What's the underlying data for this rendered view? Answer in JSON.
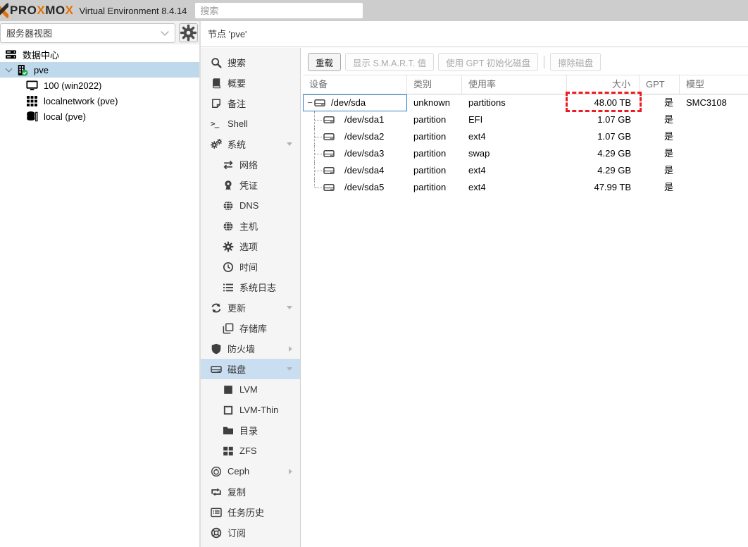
{
  "topbar": {
    "brand": "PROXMOX",
    "subtitle": "Virtual Environment 8.4.14",
    "search_placeholder": "搜索"
  },
  "sidebar": {
    "view_selector": "服务器视图",
    "tree": [
      {
        "id": "datacenter",
        "label": "数据中心",
        "icon": "server",
        "level": 0,
        "chevron": false,
        "selected": false
      },
      {
        "id": "pve",
        "label": "pve",
        "icon": "node",
        "level": 1,
        "chevron": true,
        "selected": true
      },
      {
        "id": "vm-100",
        "label": "100 (win2022)",
        "icon": "desktop",
        "level": 2,
        "chevron": false,
        "selected": false
      },
      {
        "id": "sdn-localnetwork",
        "label": "localnetwork (pve)",
        "icon": "th",
        "level": 2,
        "chevron": false,
        "selected": false
      },
      {
        "id": "storage-local",
        "label": "local (pve)",
        "icon": "storage",
        "level": 2,
        "chevron": false,
        "selected": false
      }
    ]
  },
  "content_header": {
    "title": "节点 'pve'"
  },
  "nav": {
    "items": [
      {
        "id": "search",
        "label": "搜索",
        "icon": "search",
        "level": 0,
        "chevron": "",
        "selected": false
      },
      {
        "id": "summary",
        "label": "概要",
        "icon": "book",
        "level": 0,
        "chevron": "",
        "selected": false
      },
      {
        "id": "notes",
        "label": "备注",
        "icon": "note",
        "level": 0,
        "chevron": "",
        "selected": false
      },
      {
        "id": "shell",
        "label": "Shell",
        "icon": "terminal",
        "level": 0,
        "chevron": "",
        "selected": false
      },
      {
        "id": "system",
        "label": "系统",
        "icon": "cogs",
        "level": 0,
        "chevron": "down",
        "selected": false
      },
      {
        "id": "network",
        "label": "网络",
        "icon": "exchange",
        "level": 1,
        "chevron": "",
        "selected": false
      },
      {
        "id": "certificates",
        "label": "凭证",
        "icon": "certificate",
        "level": 1,
        "chevron": "",
        "selected": false
      },
      {
        "id": "dns",
        "label": "DNS",
        "icon": "globe",
        "level": 1,
        "chevron": "",
        "selected": false
      },
      {
        "id": "hosts",
        "label": "主机",
        "icon": "globe",
        "level": 1,
        "chevron": "",
        "selected": false
      },
      {
        "id": "options",
        "label": "选项",
        "icon": "gear",
        "level": 1,
        "chevron": "",
        "selected": false
      },
      {
        "id": "time",
        "label": "时间",
        "icon": "clock",
        "level": 1,
        "chevron": "",
        "selected": false
      },
      {
        "id": "syslog",
        "label": "系统日志",
        "icon": "list",
        "level": 1,
        "chevron": "",
        "selected": false
      },
      {
        "id": "updates",
        "label": "更新",
        "icon": "refresh",
        "level": 0,
        "chevron": "down",
        "selected": false
      },
      {
        "id": "repositories",
        "label": "存储库",
        "icon": "copy",
        "level": 1,
        "chevron": "",
        "selected": false
      },
      {
        "id": "firewall",
        "label": "防火墙",
        "icon": "shield",
        "level": 0,
        "chevron": "right",
        "selected": false
      },
      {
        "id": "disks",
        "label": "磁盘",
        "icon": "hdd",
        "level": 0,
        "chevron": "down",
        "selected": true
      },
      {
        "id": "lvm",
        "label": "LVM",
        "icon": "square",
        "level": 1,
        "chevron": "",
        "selected": false
      },
      {
        "id": "lvm-thin",
        "label": "LVM-Thin",
        "icon": "square-o",
        "level": 1,
        "chevron": "",
        "selected": false
      },
      {
        "id": "directory",
        "label": "目录",
        "icon": "folder",
        "level": 1,
        "chevron": "",
        "selected": false
      },
      {
        "id": "zfs",
        "label": "ZFS",
        "icon": "th-large",
        "level": 1,
        "chevron": "",
        "selected": false
      },
      {
        "id": "ceph",
        "label": "Ceph",
        "icon": "ceph",
        "level": 0,
        "chevron": "right",
        "selected": false
      },
      {
        "id": "replication",
        "label": "复制",
        "icon": "retweet",
        "level": 0,
        "chevron": "",
        "selected": false
      },
      {
        "id": "task-history",
        "label": "任务历史",
        "icon": "list-alt",
        "level": 0,
        "chevron": "",
        "selected": false
      },
      {
        "id": "subscription",
        "label": "订阅",
        "icon": "support",
        "level": 0,
        "chevron": "",
        "selected": false
      }
    ]
  },
  "toolbar": {
    "buttons": [
      {
        "id": "reload",
        "label": "重载",
        "enabled": true
      },
      {
        "id": "show-smart",
        "label": "显示 S.M.A.R.T. 值",
        "enabled": false
      },
      {
        "id": "gpt-init",
        "label": "使用 GPT 初始化磁盘",
        "enabled": false
      },
      {
        "id": "wipe-disk",
        "label": "擦除磁盘",
        "enabled": false
      }
    ]
  },
  "disks_table": {
    "columns": [
      "设备",
      "类别",
      "使用率",
      "大小",
      "GPT",
      "模型"
    ],
    "rows": [
      {
        "device": "/dev/sda",
        "type": "unknown",
        "usage": "partitions",
        "size": "48.00 TB",
        "gpt": "是",
        "model": "SMC3108",
        "level": 0,
        "expanded": true,
        "focused": true,
        "size_annotated": true
      },
      {
        "device": "/dev/sda1",
        "type": "partition",
        "usage": "EFI",
        "size": "1.07 GB",
        "gpt": "是",
        "model": "",
        "level": 1
      },
      {
        "device": "/dev/sda2",
        "type": "partition",
        "usage": "ext4",
        "size": "1.07 GB",
        "gpt": "是",
        "model": "",
        "level": 1
      },
      {
        "device": "/dev/sda3",
        "type": "partition",
        "usage": "swap",
        "size": "4.29 GB",
        "gpt": "是",
        "model": "",
        "level": 1
      },
      {
        "device": "/dev/sda4",
        "type": "partition",
        "usage": "ext4",
        "size": "4.29 GB",
        "gpt": "是",
        "model": "",
        "level": 1
      },
      {
        "device": "/dev/sda5",
        "type": "partition",
        "usage": "ext4",
        "size": "47.99 TB",
        "gpt": "是",
        "model": "",
        "level": 1
      }
    ]
  },
  "annotation": {
    "color": "#ed1c24",
    "target": "row 0 size cell"
  },
  "colors": {
    "topbar_gray": "#cdcdcd",
    "brand_orange": "#e57000",
    "tree_selection": "#bed8ec",
    "nav_selection": "#c9dff1",
    "annotation_red": "#ed1c24",
    "node_check_green": "#1fa249"
  }
}
